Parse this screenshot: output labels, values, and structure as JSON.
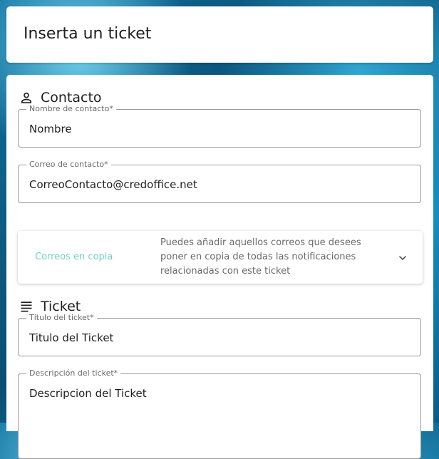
{
  "header": {
    "title": "Inserta un ticket"
  },
  "contact_section": {
    "title": "Contacto",
    "icon": "person-icon",
    "name_field": {
      "label": "Nombre de contacto*",
      "value": "Nombre"
    },
    "email_field": {
      "label": "Correo de contacto*",
      "value": "CorreoContacto@credoffice.net"
    }
  },
  "cc_panel": {
    "title": "Correos en copia",
    "description": "Puedes añadir aquellos correos que desees poner en copia de todas las notificaciones relacionadas con este ticket",
    "icon": "chevron-down-icon"
  },
  "ticket_section": {
    "title": "Ticket",
    "icon": "notes-icon",
    "title_field": {
      "label": "Título del ticket*",
      "value": "Titulo del Ticket"
    },
    "description_field": {
      "label": "Descripción del ticket*",
      "value": "Descripcion del Ticket"
    }
  },
  "colors": {
    "accent": "#6fd3c0",
    "text": "#1f1f1f",
    "muted": "#6a6a6a"
  }
}
